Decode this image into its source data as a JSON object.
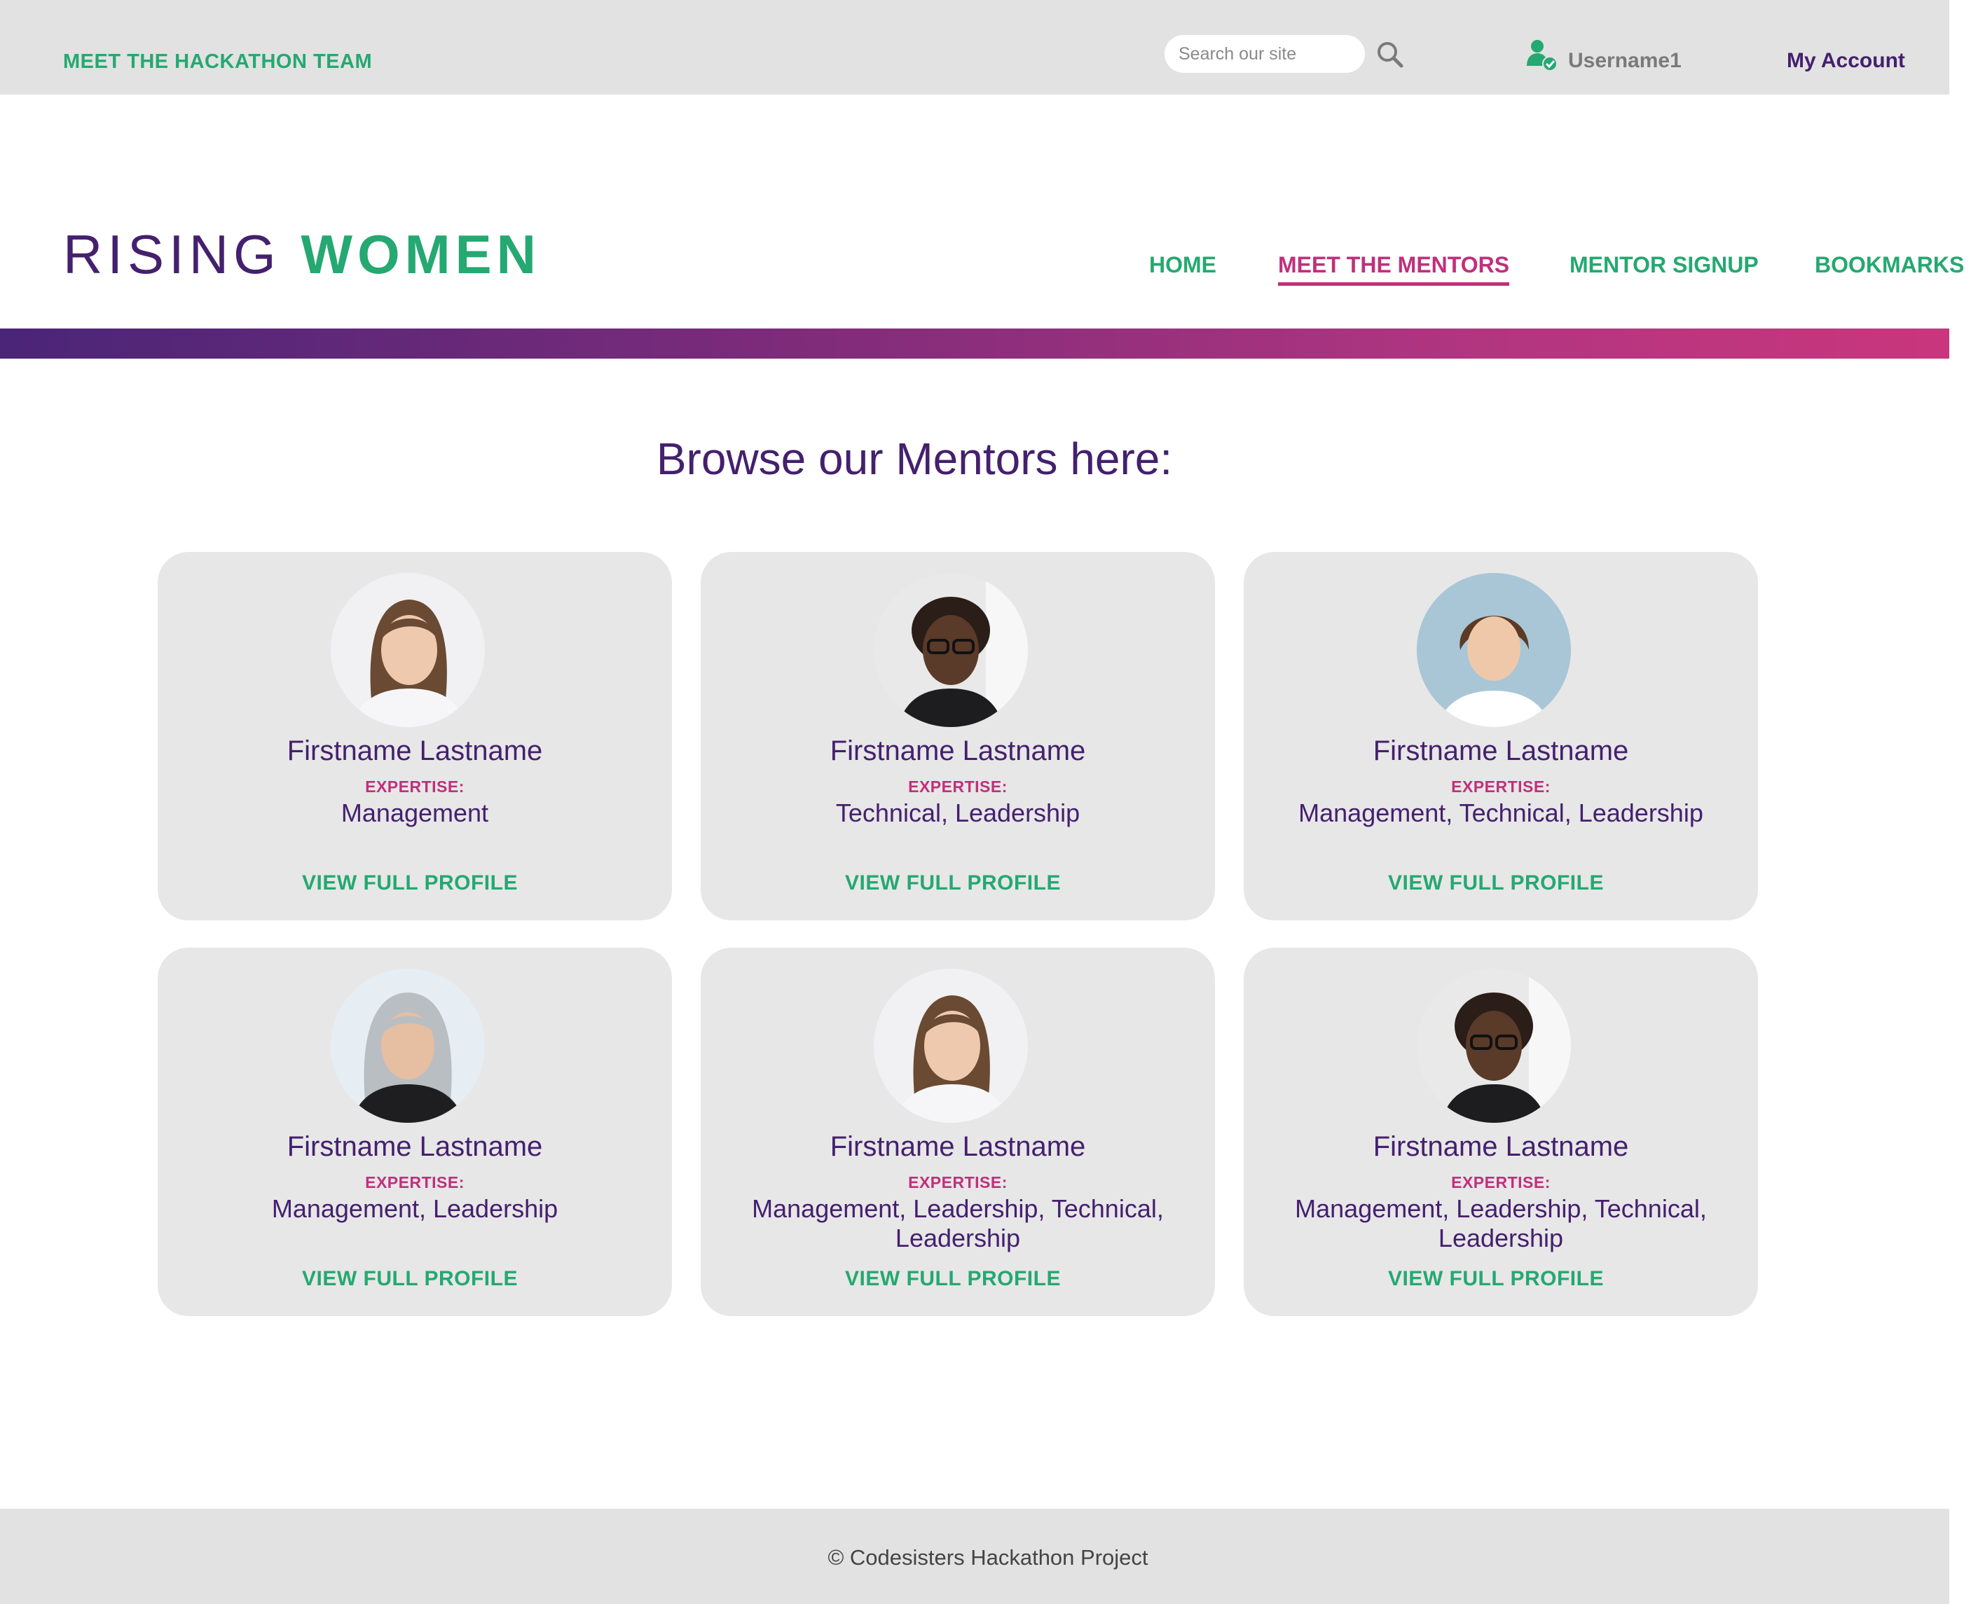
{
  "topbar": {
    "team_link": "MEET THE HACKATHON TEAM",
    "search_placeholder": "Search our site",
    "username": "Username1",
    "account_link": "My Account"
  },
  "brand": {
    "word1": "RISING",
    "word2": "WOMEN"
  },
  "nav": [
    {
      "label": "HOME",
      "active": false
    },
    {
      "label": "MEET THE MENTORS",
      "active": true
    },
    {
      "label": "MENTOR SIGNUP",
      "active": false
    },
    {
      "label": "BOOKMARKS",
      "active": false
    }
  ],
  "main": {
    "heading": "Browse our Mentors here:"
  },
  "mentors": [
    {
      "name": "Firstname Lastname",
      "expertise_label": "EXPERTISE:",
      "expertise": "Management",
      "link": "VIEW FULL PROFILE"
    },
    {
      "name": "Firstname Lastname",
      "expertise_label": "EXPERTISE:",
      "expertise": "Technical, Leadership",
      "link": "VIEW FULL PROFILE"
    },
    {
      "name": "Firstname Lastname",
      "expertise_label": "EXPERTISE:",
      "expertise": "Management, Technical, Leadership",
      "link": "VIEW FULL PROFILE"
    },
    {
      "name": "Firstname Lastname",
      "expertise_label": "EXPERTISE:",
      "expertise": "Management, Leadership",
      "link": "VIEW FULL PROFILE"
    },
    {
      "name": "Firstname Lastname",
      "expertise_label": "EXPERTISE:",
      "expertise": "Management, Leadership, Technical, Leadership",
      "link": "VIEW FULL PROFILE"
    },
    {
      "name": "Firstname Lastname",
      "expertise_label": "EXPERTISE:",
      "expertise": "Management, Leadership, Technical, Leadership",
      "link": "VIEW FULL PROFILE"
    }
  ],
  "footer": {
    "text": "© Codesisters Hackathon Project"
  },
  "colors": {
    "brand_green": "#25a871",
    "brand_purple": "#44206e",
    "accent_pink": "#c0307c",
    "card_bg": "#e7e7e7",
    "bar_bg": "#e2e2e2"
  }
}
